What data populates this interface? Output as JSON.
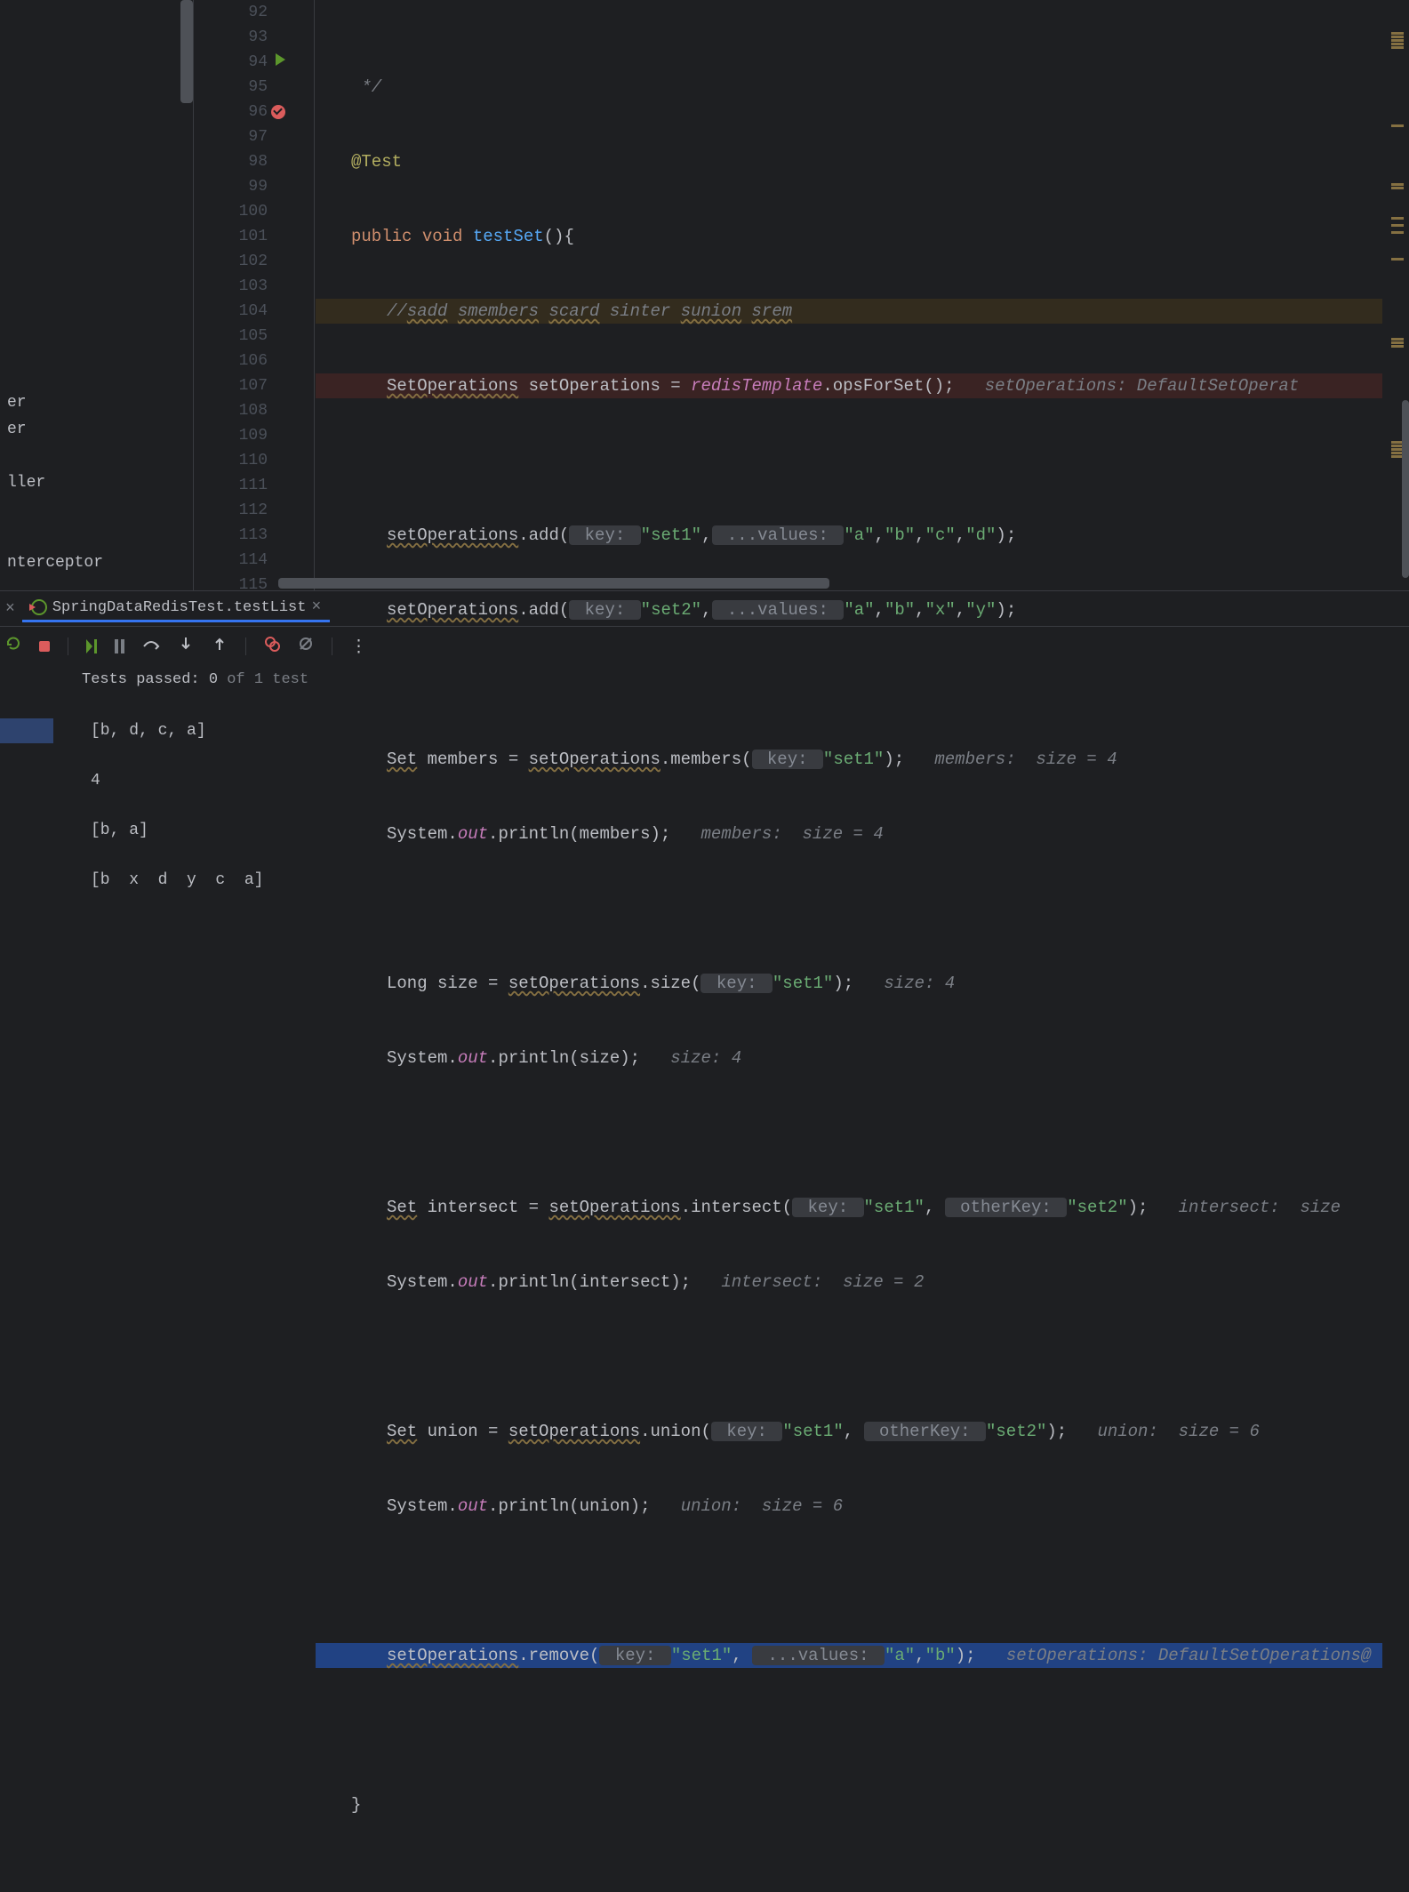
{
  "sidebar": {
    "items": [
      "er",
      "er",
      "ller",
      "nterceptor"
    ]
  },
  "gutter": {
    "start": 92,
    "end": 115
  },
  "code": {
    "l92": " */",
    "l93_ann": "@Test",
    "l94_kw": "public void ",
    "l94_m": "testSet",
    "l94_rest": "(){",
    "l95_c1": "//",
    "l95_c2": "sadd",
    "l95_c3": " ",
    "l95_c4": "smembers",
    "l95_c5": " ",
    "l95_c6": "scard",
    "l95_c7": " sinter ",
    "l95_c8": "sunion",
    "l95_c9": " ",
    "l95_c10": "srem",
    "l96_t1": "SetOperations",
    "l96_t2": " setOperations = ",
    "l96_f": "redisTemplate",
    "l96_m": ".opsForSet();",
    "l96_hint": "setOperations: DefaultSetOperat",
    "l98_a": "setOperations",
    "l98_b": ".add(",
    "l98_tag1": " key: ",
    "l98_s1": "\"set1\"",
    "l98_c": ",",
    "l98_tag2": " ...values: ",
    "l98_s2": "\"a\"",
    "l98_s3": "\"b\"",
    "l98_s4": "\"c\"",
    "l98_s5": "\"d\"",
    "l98_end": ");",
    "l99_a": "setOperations",
    "l99_b": ".add(",
    "l99_s1": "\"set2\"",
    "l99_s2": "\"a\"",
    "l99_s3": "\"b\"",
    "l99_s4": "\"x\"",
    "l99_s5": "\"y\"",
    "l101_a": "Set",
    "l101_b": " members = ",
    "l101_c": "setOperations",
    "l101_d": ".members(",
    "l101_s": "\"set1\"",
    "l101_e": ");",
    "l101_hint": "members:  size = 4",
    "l102_a": "System.",
    "l102_b": "out",
    "l102_c": ".println(members);",
    "l102_hint": "members:  size = 4",
    "l104_a": "Long size = ",
    "l104_b": "setOperations",
    "l104_c": ".size(",
    "l104_s": "\"set1\"",
    "l104_e": ");",
    "l104_hint": "size: 4",
    "l105_c": ".println(size);",
    "l105_hint": "size: 4",
    "l107_a": "Set",
    "l107_b": " intersect = ",
    "l107_c": "setOperations",
    "l107_d": ".intersect(",
    "l107_tag2": " otherKey: ",
    "l107_s1": "\"set1\"",
    "l107_s2": "\"set2\"",
    "l107_e": ");",
    "l107_hint": "intersect:  size ",
    "l108_c": ".println(intersect);",
    "l108_hint": "intersect:  size = 2",
    "l110_a": "Set",
    "l110_b": " union = ",
    "l110_c": "setOperations",
    "l110_d": ".union(",
    "l110_s1": "\"set1\"",
    "l110_s2": "\"set2\"",
    "l110_e": ");",
    "l110_hint": "union:  size = 6",
    "l111_c": ".println(union);",
    "l111_hint": "union:  size = 6",
    "l113_a": "setOperations",
    "l113_b": ".remove(",
    "l113_s1": "\"set1\"",
    "l113_s2": "\"a\"",
    "l113_s3": "\"b\"",
    "l113_e": ");",
    "l113_hint": "setOperations: DefaultSetOperations@",
    "l115": "}"
  },
  "tab": {
    "label": "SpringDataRedisTest.testList"
  },
  "tests": {
    "passed_label": "Tests passed: 0",
    "of_label": " of 1 test"
  },
  "console": {
    "l1": "[b, d, c, a]",
    "l2": "4",
    "l3": "[b, a]",
    "l4": "[b  x  d  y  c  a]"
  }
}
